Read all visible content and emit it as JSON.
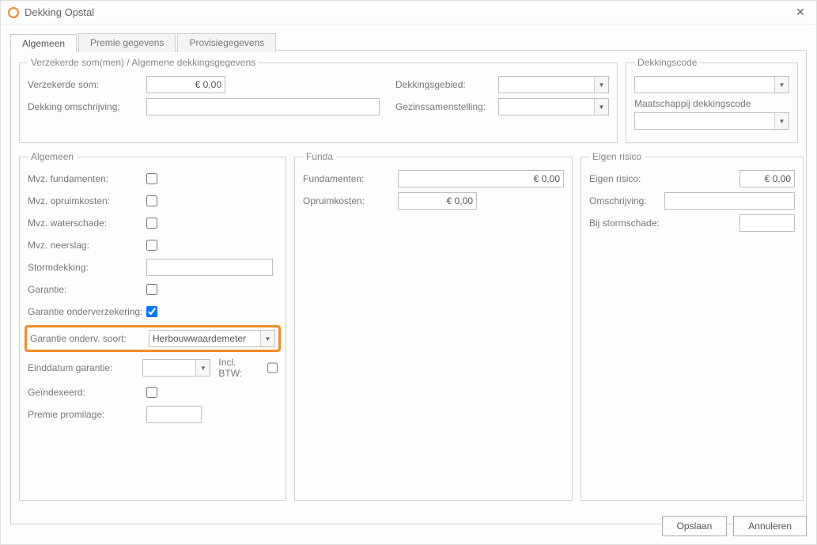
{
  "window": {
    "title": "Dekking Opstal"
  },
  "tabs": {
    "algemeen": "Algemeen",
    "premie": "Premie gegevens",
    "provisie": "Provisiegegevens"
  },
  "groups": {
    "verzekerde": "Verzekerde som(men) / Algemene dekkingsgegevens",
    "dekcode": "Dekkingscode",
    "algemeen": "Algemeen",
    "funda": "Funda",
    "eigen": "Eigen risico"
  },
  "verzekerde": {
    "som_label": "Verzekerde som:",
    "som_value": "€ 0,00",
    "omschr_label": "Dekking omschrijving:",
    "omschr_value": "",
    "gebied_label": "Dekkingsgebied:",
    "gebied_value": "",
    "gezin_label": "Gezinssamenstelling:",
    "gezin_value": ""
  },
  "dekcode": {
    "code_value": "",
    "maatsch_label": "Maatschappij dekkingscode",
    "maatsch_value": ""
  },
  "algemeen": {
    "mvz_fund_label": "Mvz. fundamenten:",
    "mvz_opr_label": "Mvz. opruimkosten:",
    "mvz_water_label": "Mvz. waterschade:",
    "mvz_neer_label": "Mvz. neerslag:",
    "storm_label": "Stormdekking:",
    "storm_value": "",
    "gar_label": "Garantie:",
    "gar_ond_label": "Garantie onderverzekering:",
    "gar_soort_label": "Garantie onderv. soort:",
    "gar_soort_value": "Herbouwwaardemeter",
    "eind_label": "Einddatum garantie:",
    "eind_value": "",
    "incl_btw_label": "Incl. BTW:",
    "geidx_label": "Geïndexeerd:",
    "premie_label": "Premie promilage:",
    "premie_value": ""
  },
  "funda": {
    "fund_label": "Fundamenten:",
    "fund_value": "€ 0,00",
    "opr_label": "Opruimkosten:",
    "opr_value": "€ 0,00"
  },
  "eigen": {
    "risico_label": "Eigen risico:",
    "risico_value": "€ 0,00",
    "omschr_label": "Omschrijving:",
    "omschr_value": "",
    "storm_label": "Bij stormschade:",
    "storm_value": ""
  },
  "footer": {
    "save": "Opslaan",
    "cancel": "Annuleren"
  }
}
